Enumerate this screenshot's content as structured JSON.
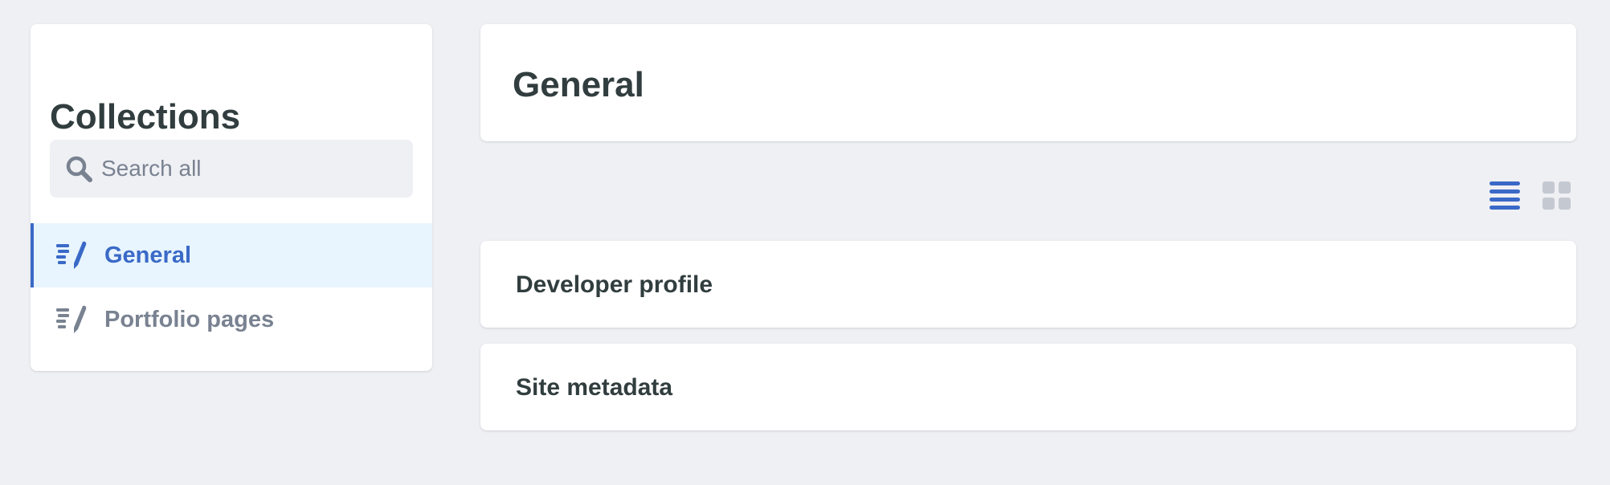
{
  "sidebar": {
    "title": "Collections",
    "search": {
      "placeholder": "Search all",
      "value": ""
    },
    "items": [
      {
        "label": "General",
        "icon": "edit-list-icon",
        "active": true
      },
      {
        "label": "Portfolio pages",
        "icon": "edit-list-icon",
        "active": false
      }
    ]
  },
  "main": {
    "title": "General",
    "view_modes": [
      {
        "name": "list",
        "icon": "list-view-icon",
        "active": true
      },
      {
        "name": "grid",
        "icon": "grid-view-icon",
        "active": false
      }
    ],
    "entries": [
      {
        "label": "Developer profile"
      },
      {
        "label": "Site metadata"
      }
    ]
  },
  "colors": {
    "background": "#eff0f4",
    "accent": "#3a69c7",
    "active_bg": "#e8f5fe",
    "text_dark": "#313d3e",
    "text_muted": "#798291",
    "icon_inactive": "#c4c8d1"
  }
}
